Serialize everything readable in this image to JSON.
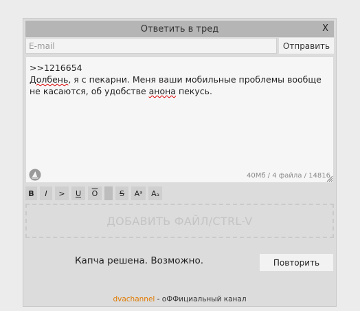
{
  "dialog": {
    "title": "Ответить в тред",
    "close_label": "X",
    "email_placeholder": "E-mail",
    "send_label": "Отправить",
    "message": {
      "line1": ">>1216654",
      "line2_word1": "Долбень",
      "line2_rest": ", я с пекарни. Меня ваши мобильные проблемы вообще",
      "line3_pre": "не касаются, об удобстве ",
      "line3_word": "анона",
      "line3_post": " пекусь."
    },
    "counter": "40Мб / 4 файла / 14816",
    "toolbar": [
      {
        "name": "bold-button",
        "label": "B"
      },
      {
        "name": "italic-button",
        "label": "I"
      },
      {
        "name": "quote-button",
        "label": ">"
      },
      {
        "name": "underline-button",
        "label": "U"
      },
      {
        "name": "overline-button",
        "label": "O"
      },
      {
        "name": "spoiler-button",
        "label": ""
      },
      {
        "name": "strike-button",
        "label": "S"
      },
      {
        "name": "superscript-button",
        "label": "Aᵃ"
      },
      {
        "name": "subscript-button",
        "label": "Aₐ"
      }
    ],
    "dropzone_label": "ДОБАВИТЬ ФАЙЛ/CTRL-V",
    "captcha_status": "Капча решена. Возможно.",
    "retry_label": "Повторить",
    "footer": {
      "link": "dvachannel",
      "text": " - оФФициальный канал"
    }
  },
  "colors": {
    "titlebar": "#b5b5b5",
    "dialog_bg": "#dcdcdc",
    "footer_link": "#e07a00"
  }
}
